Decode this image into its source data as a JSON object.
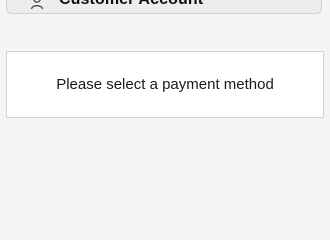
{
  "customer_account": {
    "label": "Customer Account",
    "icon": "user-icon"
  },
  "payment": {
    "message": "Please select a payment method"
  }
}
